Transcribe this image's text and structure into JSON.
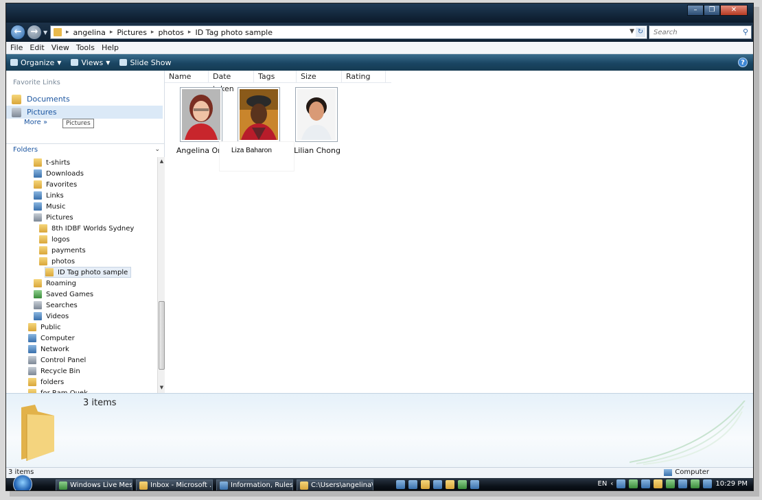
{
  "address": {
    "crumbs": [
      "angelina",
      "Pictures",
      "photos",
      "ID Tag photo sample"
    ],
    "search_placeholder": "Search"
  },
  "menu": [
    "File",
    "Edit",
    "View",
    "Tools",
    "Help"
  ],
  "toolbar": {
    "organize": "Organize",
    "views": "Views",
    "slideshow": "Slide Show"
  },
  "nav": {
    "favorites_title": "Favorite Links",
    "favorites": [
      "Documents",
      "Pictures"
    ],
    "more": "More",
    "tooltip": "Pictures",
    "folders_header": "Folders"
  },
  "tree": [
    {
      "label": "t-shirts",
      "icon": "folder-icon"
    },
    {
      "label": "Downloads",
      "icon": "downloads-icon"
    },
    {
      "label": "Favorites",
      "icon": "favorites-icon"
    },
    {
      "label": "Links",
      "icon": "links-icon"
    },
    {
      "label": "Music",
      "icon": "music-icon"
    },
    {
      "label": "Pictures",
      "icon": "pictures-icon"
    },
    {
      "label": "8th IDBF Worlds Sydney",
      "icon": "folder-icon"
    },
    {
      "label": "logos",
      "icon": "folder-icon"
    },
    {
      "label": "payments",
      "icon": "folder-icon"
    },
    {
      "label": "photos",
      "icon": "folder-icon"
    },
    {
      "label": "ID Tag photo sample",
      "icon": "folder-icon",
      "selected": true
    },
    {
      "label": "Roaming",
      "icon": "folder-icon"
    },
    {
      "label": "Saved Games",
      "icon": "saved-games-icon"
    },
    {
      "label": "Searches",
      "icon": "searches-icon"
    },
    {
      "label": "Videos",
      "icon": "videos-icon"
    },
    {
      "label": "Public",
      "icon": "folder-icon"
    },
    {
      "label": "Computer",
      "icon": "computer-icon"
    },
    {
      "label": "Network",
      "icon": "network-icon"
    },
    {
      "label": "Control Panel",
      "icon": "control-panel-icon"
    },
    {
      "label": "Recycle Bin",
      "icon": "recycle-bin-icon"
    },
    {
      "label": "folders",
      "icon": "folder-icon"
    },
    {
      "label": "for Ram Quek",
      "icon": "folder-icon"
    }
  ],
  "columns": [
    "Name",
    "Date taken",
    "Tags",
    "Size",
    "Rating"
  ],
  "files": [
    {
      "name": "Angelina Ong"
    },
    {
      "name": "Liza Baharon",
      "editing": true
    },
    {
      "name": "Lilian Chong"
    }
  ],
  "details": {
    "count": "3 items"
  },
  "status": {
    "left": "3 items",
    "right": "Computer"
  },
  "taskbar": {
    "tasks": [
      "Windows Live Mes...",
      "Inbox - Microsoft ...",
      "Information, Rules ...",
      "C:\\Users\\angelina\\..."
    ],
    "lang": "EN",
    "clock": "10:29 PM"
  },
  "colors": {
    "toolbar": "#1a4663",
    "link": "#1b55a0",
    "folder": "#e9b94a"
  }
}
